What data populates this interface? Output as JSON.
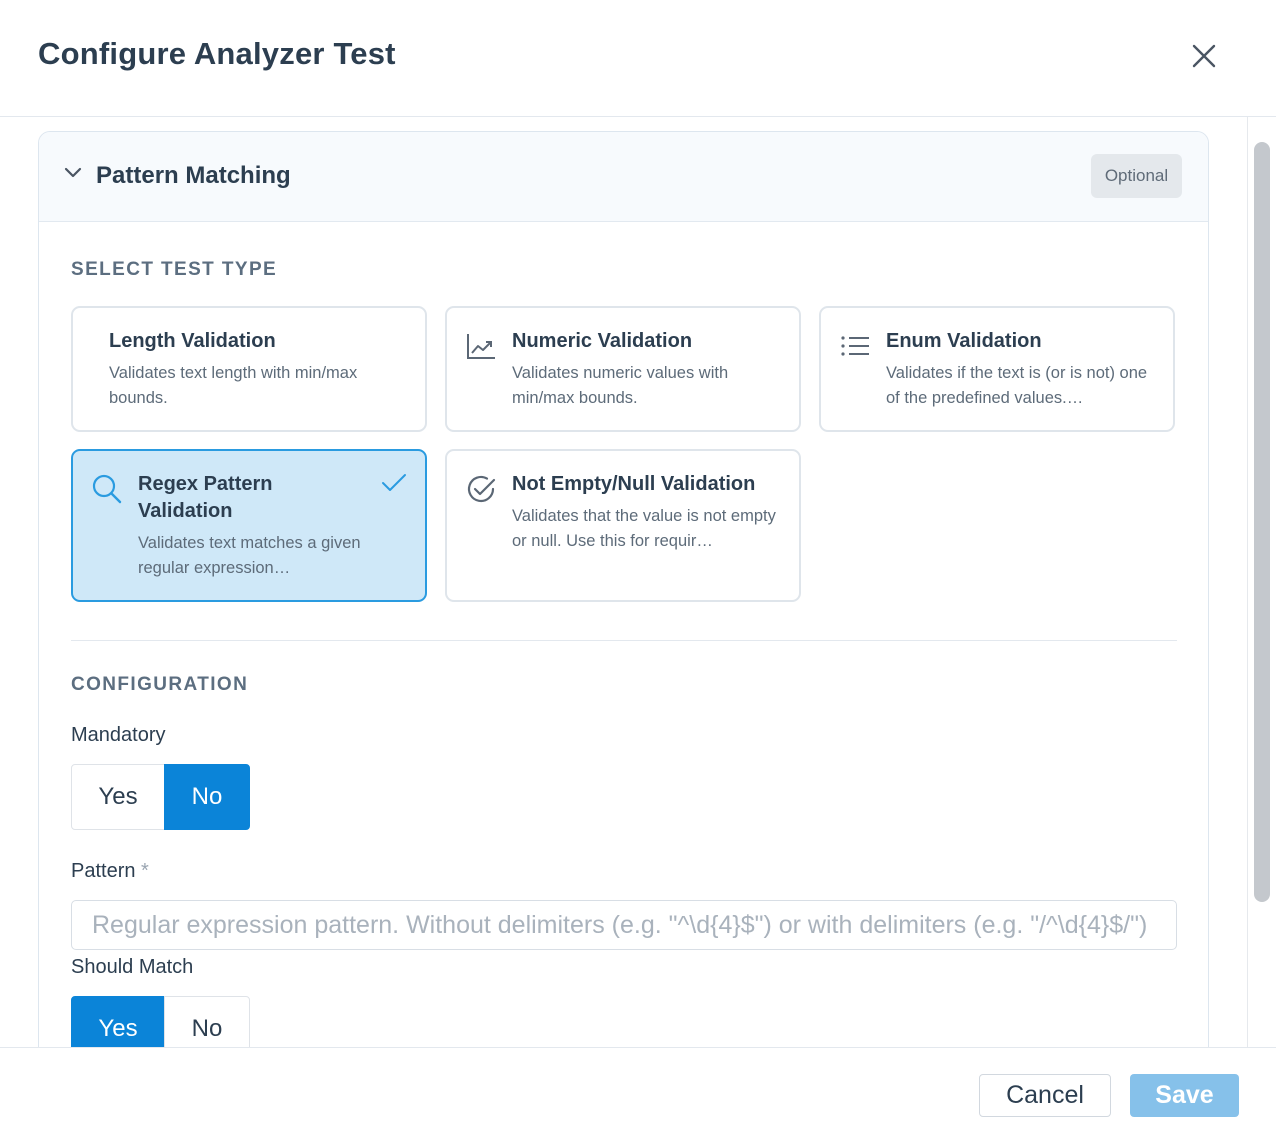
{
  "header": {
    "title": "Configure Analyzer Test",
    "close_icon": "close-icon"
  },
  "panel": {
    "title": "Pattern Matching",
    "badge": "Optional",
    "expanded": true
  },
  "test_type": {
    "section_label": "SELECT TEST TYPE",
    "cards": [
      {
        "title": "Length Validation",
        "description": "Validates text length with min/max bounds.",
        "icon": "none",
        "selected": false
      },
      {
        "title": "Numeric Validation",
        "description": "Validates numeric values with min/max bounds.",
        "icon": "chart-trend-icon",
        "selected": false
      },
      {
        "title": "Enum Validation",
        "description": "Validates if the text is (or is not) one of the predefined values.…",
        "icon": "list-icon",
        "selected": false
      },
      {
        "title": "Regex Pattern Validation",
        "description": "Validates text matches a given regular expression…",
        "icon": "search-icon",
        "selected": true
      },
      {
        "title": "Not Empty/Null Validation",
        "description": "Validates that the value is not empty or null. Use this for requir…",
        "icon": "check-circle-icon",
        "selected": false
      }
    ]
  },
  "configuration": {
    "section_label": "CONFIGURATION",
    "mandatory": {
      "label": "Mandatory",
      "options": [
        "Yes",
        "No"
      ],
      "selected": "No"
    },
    "pattern": {
      "label": "Pattern",
      "required_mark": "*",
      "value": "",
      "placeholder": "Regular expression pattern. Without delimiters (e.g. \"^\\d{4}$\") or with delimiters (e.g. \"/^\\d{4}$/\")"
    },
    "should_match": {
      "label": "Should Match",
      "options": [
        "Yes",
        "No"
      ],
      "selected": "Yes"
    }
  },
  "footer": {
    "cancel_label": "Cancel",
    "save_label": "Save"
  },
  "colors": {
    "accent": "#0b84d8",
    "selected_card_bg": "#cfe8f8",
    "save_disabled": "#86c1ea"
  }
}
